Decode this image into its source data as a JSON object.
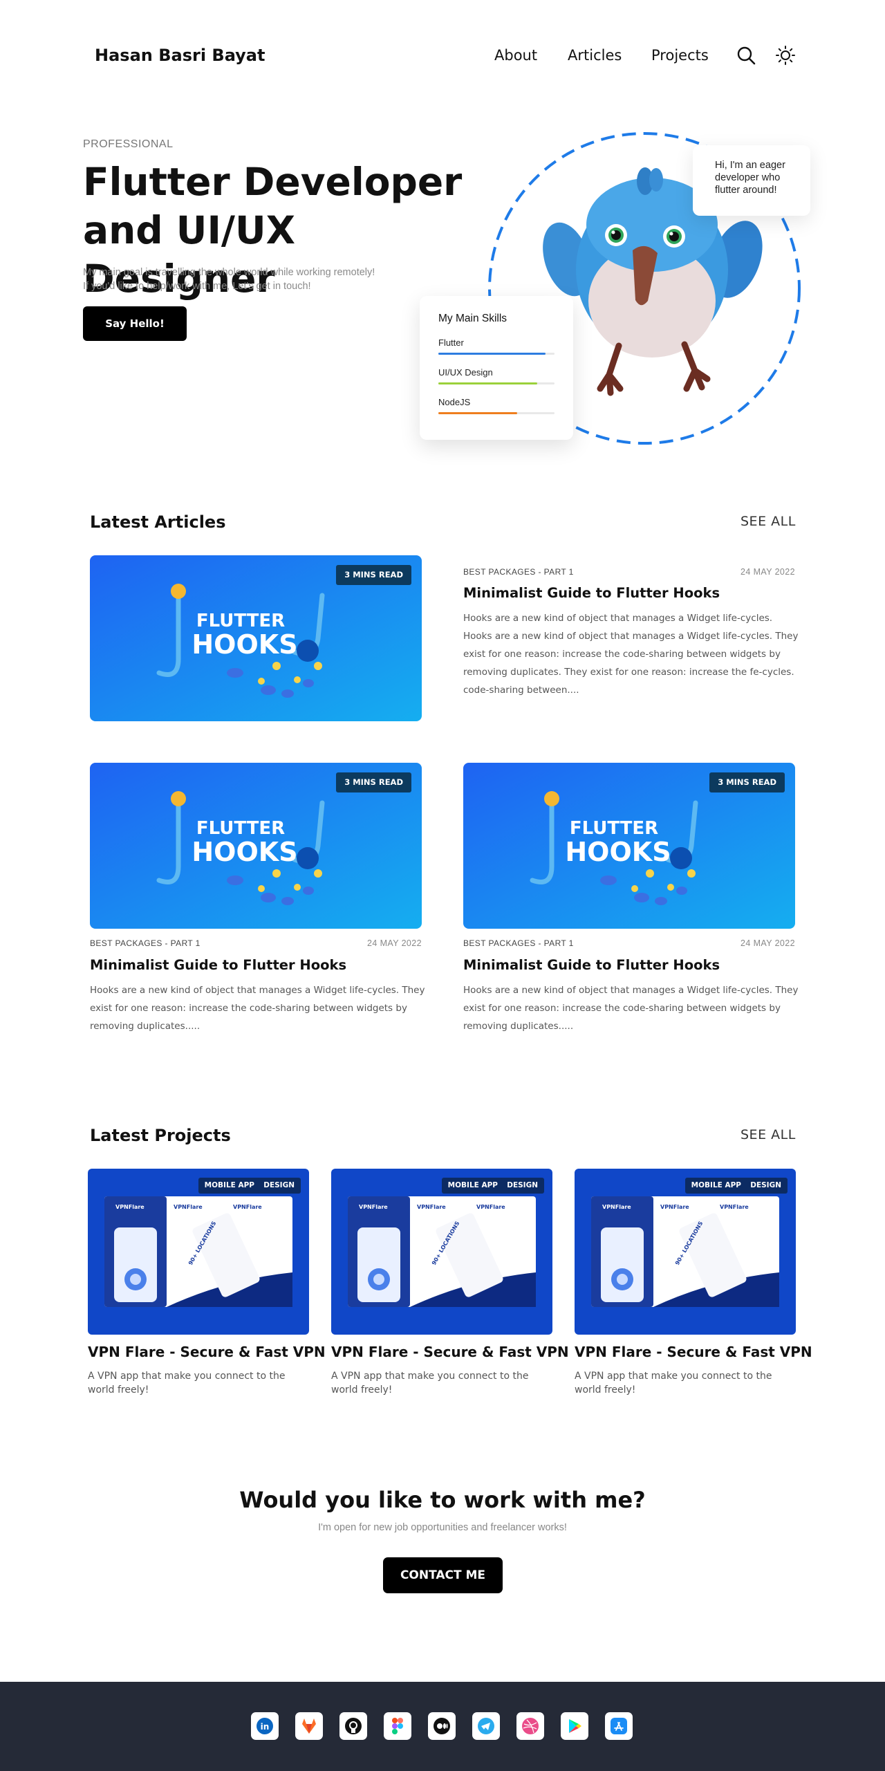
{
  "header": {
    "brand": "Hasan Basri Bayat",
    "nav": {
      "about": "About",
      "articles": "Articles",
      "projects": "Projects"
    },
    "icons": [
      "search-icon",
      "sun-icon"
    ]
  },
  "hero": {
    "kicker": "PROFESSIONAL",
    "title": "Flutter Developer and UI/UX Designer",
    "desc_line1": "My main goal is travelling the whole world while working remotely!",
    "desc_line2": "If you'd like to help/work with me, Let's get in touch!",
    "button": "Say Hello!",
    "bubble": "Hi, I'm an eager developer who flutter around!",
    "skills": {
      "title": "My Main Skills",
      "items": [
        {
          "name": "Flutter",
          "level": 0.92,
          "color": "#2e7de0"
        },
        {
          "name": "UI/UX Design",
          "level": 0.85,
          "color": "#9bd13a"
        },
        {
          "name": "NodeJS",
          "level": 0.68,
          "color": "#ef7e1e"
        }
      ]
    },
    "accent_color": "#1e7be8"
  },
  "articles": {
    "title": "Latest Articles",
    "see_all": "SEE ALL",
    "image_text_line1": "FLUTTER",
    "image_text_line2": "HOOKS",
    "items": [
      {
        "badge": "3 MINS READ",
        "category": "BEST PACKAGES - PART 1",
        "date": "24 MAY 2022",
        "title": "Minimalist Guide to Flutter Hooks",
        "desc": "Hooks are a new kind of object that manages a Widget life-cycles. Hooks are a new kind of object that manages a Widget life-cycles. They exist for one reason: increase the code-sharing between widgets by removing duplicates. They exist for one reason: increase the fe-cycles. code-sharing between...."
      },
      {
        "badge": "3 MINS READ",
        "category": "BEST PACKAGES - PART 1",
        "date": "24 MAY 2022",
        "title": "Minimalist Guide to Flutter Hooks",
        "desc": "Hooks are a new kind of object that manages a Widget life-cycles. They exist for one reason: increase the code-sharing between widgets by removing duplicates....."
      },
      {
        "badge": "3 MINS READ",
        "category": "BEST PACKAGES - PART 1",
        "date": "24 MAY 2022",
        "title": "Minimalist Guide to Flutter Hooks",
        "desc": "Hooks are a new kind of object that manages a Widget life-cycles. They exist for one reason: increase the code-sharing between widgets by removing duplicates....."
      }
    ]
  },
  "projects": {
    "title": "Latest Projects",
    "see_all": "SEE ALL",
    "mock_logo": "VPNFlare",
    "mock_text": "90+ LOCATIONS",
    "items": [
      {
        "tag1": "MOBILE APP",
        "tag2": "DESIGN",
        "title": "VPN Flare - Secure & Fast VPN",
        "desc": "A VPN app that make you connect to the world freely!"
      },
      {
        "tag1": "MOBILE APP",
        "tag2": "DESIGN",
        "title": "VPN Flare - Secure & Fast VPN",
        "desc": "A VPN app that make you connect to the world freely!"
      },
      {
        "tag1": "MOBILE APP",
        "tag2": "DESIGN",
        "title": "VPN Flare - Secure & Fast VPN",
        "desc": "A VPN app that make you connect to the world freely!"
      }
    ]
  },
  "cta": {
    "title": "Would you like to work with me?",
    "subtitle": "I'm open for new job opportunities and freelancer works!",
    "button": "CONTACT ME"
  },
  "footer": {
    "socials": [
      "linkedin-icon",
      "gitlab-icon",
      "github-icon",
      "figma-icon",
      "medium-icon",
      "telegram-icon",
      "dribbble-icon",
      "google-play-icon",
      "app-store-icon"
    ],
    "background": "#252a37"
  }
}
